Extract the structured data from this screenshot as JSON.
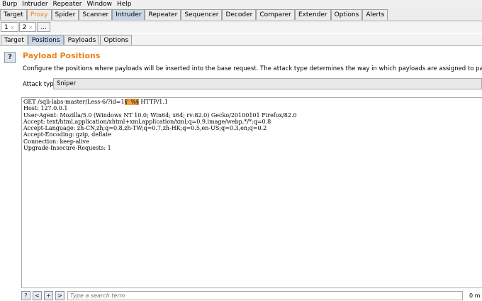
{
  "menu": [
    "Burp",
    "Intruder",
    "Repeater",
    "Window",
    "Help"
  ],
  "main_tabs": [
    "Target",
    "Proxy",
    "Spider",
    "Scanner",
    "Intruder",
    "Repeater",
    "Sequencer",
    "Decoder",
    "Comparer",
    "Extender",
    "Options",
    "Alerts"
  ],
  "session_tabs": [
    {
      "label": "1",
      "close": "×"
    },
    {
      "label": "2",
      "close": "×"
    },
    {
      "label": "..."
    }
  ],
  "intruder_tabs": [
    "Target",
    "Positions",
    "Payloads",
    "Options"
  ],
  "panel": {
    "help": "?",
    "title": "Payload Positions",
    "description": "Configure the positions where payloads will be inserted into the base request. The attack type determines the way in which payloads are assigned to payload positions - see help for",
    "attack_type_label": "Attack type:",
    "attack_type_value": "Sniper"
  },
  "request": {
    "line1_before": "GET /sqli-labs-master/Less-6/?id=1",
    "line1_marked": "§' %§",
    "line1_after": " HTTP/1.1",
    "lines": [
      "Host: 127.0.0.1",
      "User-Agent: Mozilla/5.0 (Windows NT 10.0; Win64; x64; rv:82.0) Gecko/20100101 Firefox/82.0",
      "Accept: text/html,application/xhtml+xml,application/xml;q=0.9,image/webp,*/*;q=0.8",
      "Accept-Language: zh-CN,zh;q=0.8,zh-TW;q=0.7,zh-HK;q=0.5,en-US;q=0.3,en;q=0.2",
      "Accept-Encoding: gzip, deflate",
      "Connection: keep-alive",
      "Upgrade-Insecure-Requests: 1"
    ]
  },
  "bottom": {
    "help": "?",
    "prev_lt": "<",
    "add": "+",
    "next_gt": ">",
    "search_placeholder": "Type a search term",
    "matches": "0 m"
  },
  "colors": {
    "accent": "#e9821b",
    "marker": "#ef9f48",
    "active_tab": "#c9d6e8"
  }
}
